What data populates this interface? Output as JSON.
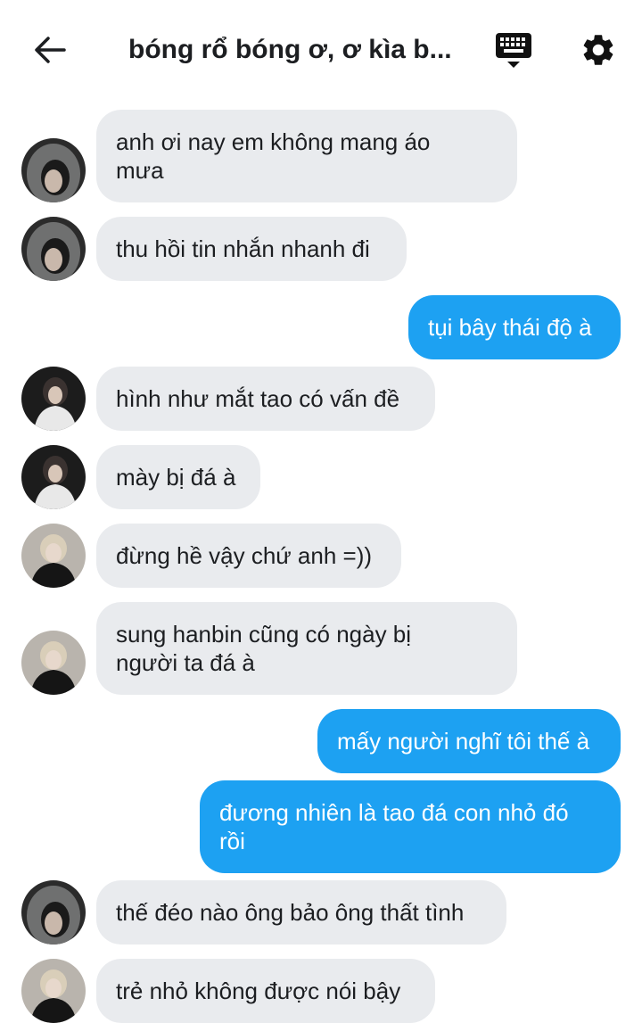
{
  "header": {
    "back_icon": "arrow-left-icon",
    "title": "bóng rổ bóng ơ, ơ kìa b...",
    "keyboard_icon": "keyboard-icon",
    "settings_icon": "gear-icon"
  },
  "colors": {
    "incoming_bubble": "#e9ebee",
    "outgoing_bubble": "#1da1f2"
  },
  "messages": [
    {
      "direction": "in",
      "sender_avatar": "avatar-hood",
      "text": "anh ơi nay em không mang áo\nmưa"
    },
    {
      "direction": "in",
      "sender_avatar": "avatar-hood",
      "text": "thu hồi tin nhắn nhanh đi"
    },
    {
      "direction": "out",
      "text": "tụi bây thái độ à"
    },
    {
      "direction": "in",
      "sender_avatar": "avatar-white-shirt",
      "text": "hình như mắt tao có vấn đề"
    },
    {
      "direction": "in",
      "sender_avatar": "avatar-white-shirt",
      "text": "mày bị đá à"
    },
    {
      "direction": "in",
      "sender_avatar": "avatar-blond",
      "text": "đừng hề vậy chứ anh =))"
    },
    {
      "direction": "in",
      "sender_avatar": "avatar-blond",
      "text": "sung hanbin cũng có ngày bị\nngười ta đá à"
    },
    {
      "direction": "out",
      "text": "mấy người nghĩ tôi thế à"
    },
    {
      "direction": "out",
      "text": "đương nhiên là tao đá con nhỏ đó\nrồi"
    },
    {
      "direction": "in",
      "sender_avatar": "avatar-hood",
      "text": "thế đéo nào ông bảo ông thất tình"
    },
    {
      "direction": "in",
      "sender_avatar": "avatar-blond",
      "text": "trẻ nhỏ không được nói bậy"
    }
  ]
}
